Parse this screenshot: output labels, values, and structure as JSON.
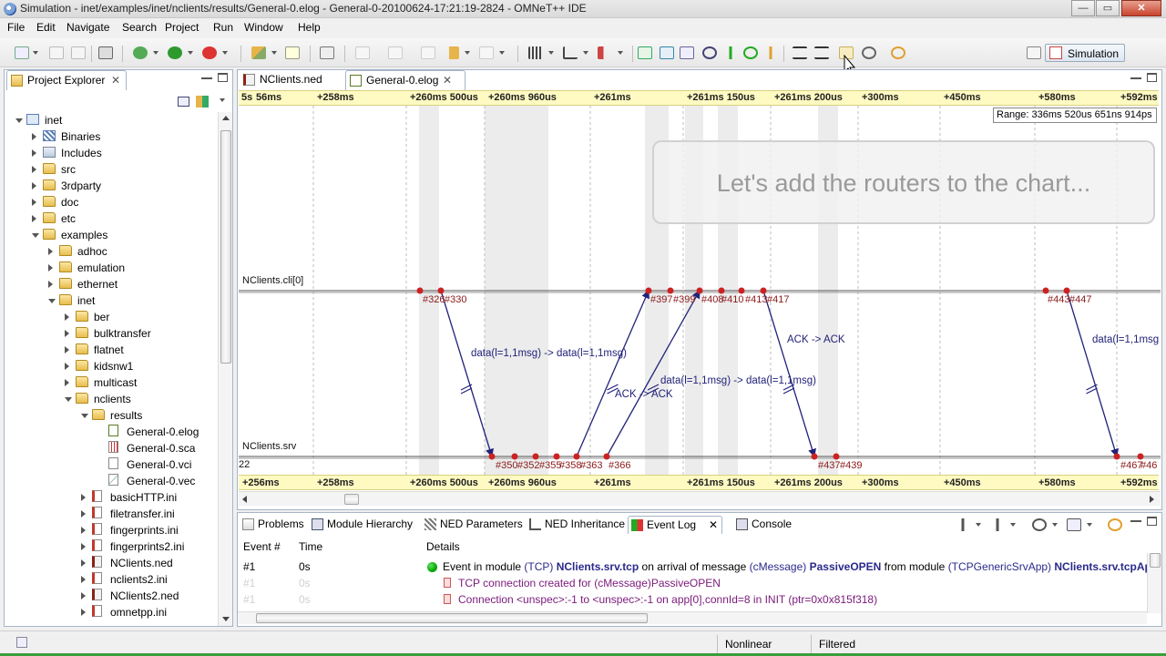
{
  "window": {
    "title": "Simulation - inet/examples/inet/nclients/results/General-0.elog - General-0-20100624-17:21:19-2824 - OMNeT++ IDE",
    "min_label": "—",
    "max_label": "▭",
    "close_label": "✕"
  },
  "menu": [
    "File",
    "Edit",
    "Navigate",
    "Search",
    "Project",
    "Run",
    "Window",
    "Help"
  ],
  "toolbar": {
    "perspective_label": "Simulation",
    "icons": [
      "new-wizard-icon",
      "save-icon",
      "print-icon",
      "build-icon",
      "debug-icon",
      "run-icon",
      "profile-icon",
      "brush-icon",
      "open-type-icon",
      "search-icon",
      "back-icon",
      "forward-icon",
      "event-filter-icon",
      "timeline-mode-icon",
      "zoom-in-icon",
      "zoom-out-icon",
      "refresh-icon"
    ]
  },
  "project_explorer": {
    "title": "Project Explorer",
    "close": "✕",
    "tree": [
      {
        "label": "inet",
        "level": 0,
        "icon": "project",
        "open": true
      },
      {
        "label": "Binaries",
        "level": 1,
        "icon": "binaries",
        "open": false
      },
      {
        "label": "Includes",
        "level": 1,
        "icon": "includes",
        "open": false
      },
      {
        "label": "src",
        "level": 1,
        "icon": "folder",
        "open": false
      },
      {
        "label": "3rdparty",
        "level": 1,
        "icon": "folder",
        "open": false
      },
      {
        "label": "doc",
        "level": 1,
        "icon": "folder",
        "open": false
      },
      {
        "label": "etc",
        "level": 1,
        "icon": "folder",
        "open": false
      },
      {
        "label": "examples",
        "level": 1,
        "icon": "folder",
        "open": true
      },
      {
        "label": "adhoc",
        "level": 2,
        "icon": "folder",
        "open": false
      },
      {
        "label": "emulation",
        "level": 2,
        "icon": "folder",
        "open": false
      },
      {
        "label": "ethernet",
        "level": 2,
        "icon": "folder",
        "open": false
      },
      {
        "label": "inet",
        "level": 2,
        "icon": "folder",
        "open": true
      },
      {
        "label": "ber",
        "level": 3,
        "icon": "folder",
        "open": false
      },
      {
        "label": "bulktransfer",
        "level": 3,
        "icon": "folder",
        "open": false
      },
      {
        "label": "flatnet",
        "level": 3,
        "icon": "folder",
        "open": false
      },
      {
        "label": "kidsnw1",
        "level": 3,
        "icon": "folder",
        "open": false
      },
      {
        "label": "multicast",
        "level": 3,
        "icon": "folder",
        "open": false
      },
      {
        "label": "nclients",
        "level": 3,
        "icon": "folder",
        "open": true
      },
      {
        "label": "results",
        "level": 4,
        "icon": "folder",
        "open": true
      },
      {
        "label": "General-0.elog",
        "level": 5,
        "icon": "elog",
        "leaf": true
      },
      {
        "label": "General-0.sca",
        "level": 5,
        "icon": "sca",
        "leaf": true
      },
      {
        "label": "General-0.vci",
        "level": 5,
        "icon": "vci",
        "leaf": true
      },
      {
        "label": "General-0.vec",
        "level": 5,
        "icon": "vec",
        "leaf": true
      },
      {
        "label": "basicHTTP.ini",
        "level": 4,
        "icon": "ini",
        "open": false
      },
      {
        "label": "filetransfer.ini",
        "level": 4,
        "icon": "ini",
        "open": false
      },
      {
        "label": "fingerprints.ini",
        "level": 4,
        "icon": "ini",
        "open": false
      },
      {
        "label": "fingerprints2.ini",
        "level": 4,
        "icon": "ini",
        "open": false
      },
      {
        "label": "NClients.ned",
        "level": 4,
        "icon": "ned",
        "open": false
      },
      {
        "label": "nclients2.ini",
        "level": 4,
        "icon": "ini",
        "open": false
      },
      {
        "label": "NClients2.ned",
        "level": 4,
        "icon": "ned",
        "open": false
      },
      {
        "label": "omnetpp.ini",
        "level": 4,
        "icon": "ini",
        "open": false
      }
    ]
  },
  "editor_tabs": [
    {
      "label": "NClients.ned",
      "active": false
    },
    {
      "label": "General-0.elog",
      "active": true,
      "close": "✕"
    }
  ],
  "sequence_chart": {
    "top_axis": {
      "first": "5s",
      "ticks": [
        "56ms",
        "+258ms",
        "+260ms 500us",
        "+260ms 960us",
        "+261ms",
        "+261ms 150us",
        "+261ms 200us",
        "+300ms",
        "+450ms",
        "+580ms",
        "+592ms"
      ]
    },
    "bottom_axis": {
      "ticks": [
        "+256ms",
        "+258ms",
        "+260ms 500us",
        "+260ms 960us",
        "+261ms",
        "+261ms 150us",
        "+261ms 200us",
        "+300ms",
        "+450ms",
        "+580ms",
        "+592ms"
      ]
    },
    "range": "Range: 336ms 520us 651ns 914ps",
    "hint": "Let's add the routers to the chart...",
    "axes": [
      {
        "name": "NClients.cli[0]"
      },
      {
        "name": "NClients.srv",
        "prefix": "22"
      }
    ],
    "cli_event_labels": [
      "#326",
      "#330",
      "#397",
      "#399",
      "#408",
      "#410",
      "#413",
      "#417",
      "#443",
      "#447"
    ],
    "srv_event_labels": [
      "#350",
      "#352",
      "#355",
      "#358",
      "#363",
      "#366",
      "#437",
      "#439",
      "#467",
      "#46"
    ],
    "messages": [
      {
        "label": "data(l=1,1msg) -> data(l=1,1msg)"
      },
      {
        "label": "ACK -> ACK"
      },
      {
        "label": "data(l=1,1msg) -> data(l=1,1msg)"
      },
      {
        "label": "ACK -> ACK"
      },
      {
        "label": "data(l=1,1msg"
      }
    ]
  },
  "bottom_tabs": [
    {
      "label": "Problems",
      "icon": "problems-icon"
    },
    {
      "label": "Module Hierarchy",
      "icon": "module-hierarchy-icon"
    },
    {
      "label": "NED Parameters",
      "icon": "ned-parameters-icon"
    },
    {
      "label": "NED Inheritance",
      "icon": "ned-inheritance-icon"
    },
    {
      "label": "Event Log",
      "icon": "event-log-icon",
      "active": true,
      "close": "✕"
    },
    {
      "label": "Console",
      "icon": "console-icon"
    }
  ],
  "event_log": {
    "columns": [
      "Event #",
      "Time",
      "Details"
    ],
    "rows": [
      {
        "event": "#1",
        "time": "0s",
        "details": {
          "p1": "Event in module ",
          "p2": "(TCP) ",
          "p3": "NClients.srv.tcp",
          "p4": " on arrival of message ",
          "p5": "(cMessage) ",
          "p6": "PassiveOPEN",
          "p7": " from module ",
          "p8": "(TCPGenericSrvApp) ",
          "p9": "NClients.srv.tcpApp["
        }
      },
      {
        "event": "#1",
        "time": "0s",
        "details": {
          "text": "TCP connection created for (cMessage)PassiveOPEN"
        }
      },
      {
        "event": "#1",
        "time": "0s",
        "details": {
          "text": "Connection <unspec>:-1 to <unspec>:-1  on app[0],connId=8  in INIT  (ptr=0x0x815f318)"
        }
      }
    ]
  },
  "status_bar": {
    "mode": "Nonlinear",
    "filter": "Filtered"
  },
  "colors": {
    "axis_bar": "#fffac2",
    "message_arrow": "#22227a",
    "event_marker": "#cc2222",
    "event_label": "#8b1a1a"
  }
}
